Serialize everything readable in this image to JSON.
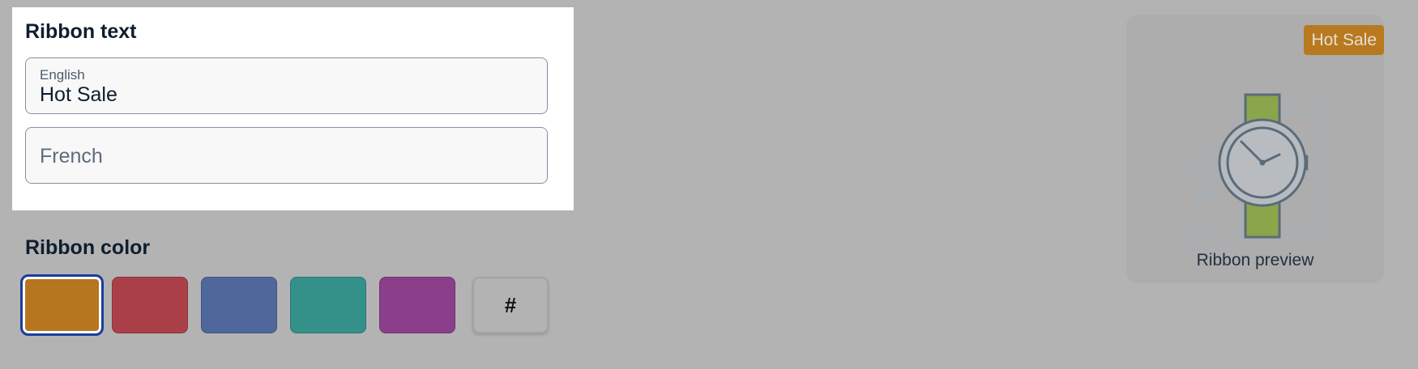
{
  "ribbon_text": {
    "heading": "Ribbon text",
    "english": {
      "label": "English",
      "value": "Hot Sale"
    },
    "french": {
      "placeholder": "French",
      "value": ""
    }
  },
  "ribbon_color": {
    "heading": "Ribbon color",
    "selected_index": 0,
    "swatches": [
      {
        "color": "#b67620"
      },
      {
        "color": "#ab3f47"
      },
      {
        "color": "#50679b"
      },
      {
        "color": "#34918a"
      },
      {
        "color": "#8b3f8a"
      }
    ],
    "custom_label": "#"
  },
  "preview": {
    "ribbon_label": "Hot Sale",
    "ribbon_color": "#b8791f",
    "caption": "Ribbon preview"
  },
  "icons": {
    "preview_image": "watch-illustration-icon"
  }
}
